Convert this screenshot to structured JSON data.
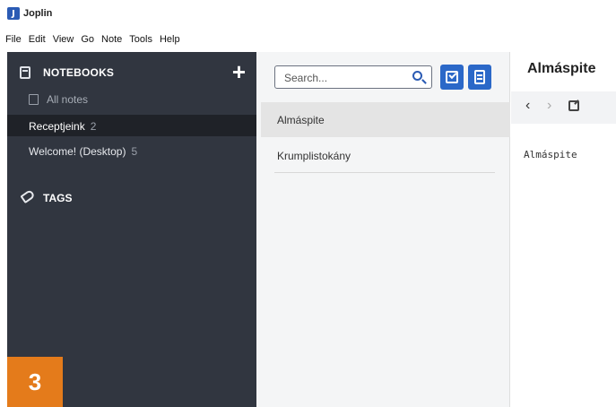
{
  "window": {
    "title": "Joplin",
    "app_icon_letter": "J"
  },
  "menu": [
    "File",
    "Edit",
    "View",
    "Go",
    "Note",
    "Tools",
    "Help"
  ],
  "sidebar": {
    "notebooks_title": "NOTEBOOKS",
    "add_label": "+",
    "all_notes": "All notes",
    "notebooks": [
      {
        "label": "Receptjeink",
        "count": "2",
        "selected": true
      },
      {
        "label": "Welcome! (Desktop)",
        "count": "5",
        "selected": false
      }
    ],
    "tags_title": "TAGS"
  },
  "badge": "3",
  "notelist": {
    "search_placeholder": "Search...",
    "notes": [
      {
        "title": "Almáspite",
        "selected": true
      },
      {
        "title": "Krumplistokány",
        "selected": false
      }
    ]
  },
  "editor": {
    "title": "Almáspite",
    "back": "‹",
    "forward": "›",
    "body": "Almáspite"
  },
  "colors": {
    "sidebar_bg": "#313640",
    "selected_bg": "#1f2228",
    "accent": "#2b68c8",
    "badge": "#e47b1b"
  }
}
